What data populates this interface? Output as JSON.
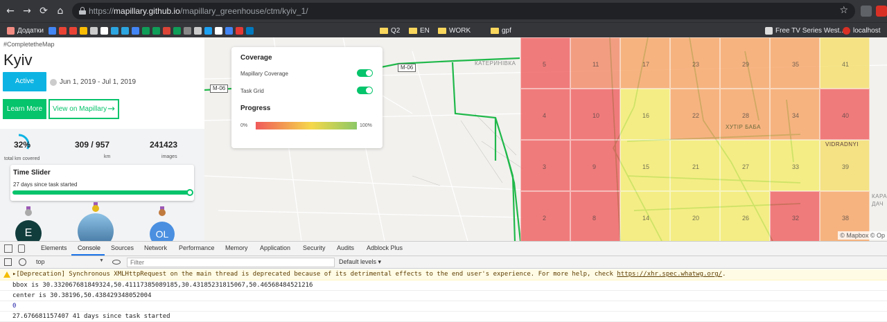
{
  "browser": {
    "url_host": "mapillary.github.io",
    "url_path": "/mapillary_greenhouse/ctm/kyiv_1/",
    "url_scheme": "https://",
    "bookmarks": [
      "Додатки",
      "Q2",
      "EN",
      "WORK",
      "gpf",
      "Free TV Series West...",
      "localhost"
    ]
  },
  "sidebar": {
    "hashtag": "#CompletetheMap",
    "city": "Kyiv",
    "active_label": "Active",
    "dates": "Jun 1, 2019 - Jul 1, 2019",
    "learn_more": "Learn More",
    "view_on": "View on Mapillary",
    "percent": "32%",
    "percent_value": 0.32,
    "percent_caption": "total km covered",
    "km": "309 / 957",
    "km_caption": "km",
    "images": "241423",
    "images_caption": "images",
    "slider_title": "Time Slider",
    "slider_sub": "27 days since task started",
    "slider_value": 1.0,
    "avatars": [
      "E",
      "",
      "OL"
    ]
  },
  "overlay": {
    "coverage_title": "Coverage",
    "mapillary_coverage": "Mapillary Coverage",
    "task_grid": "Task Grid",
    "progress_title": "Progress",
    "pct_min": "0%",
    "pct_max": "100%"
  },
  "map": {
    "grid": [
      [
        "5",
        "11",
        "17",
        "23",
        "29",
        "35",
        "41"
      ],
      [
        "4",
        "10",
        "16",
        "22",
        "28",
        "34",
        "40"
      ],
      [
        "3",
        "9",
        "15",
        "21",
        "27",
        "33",
        "39"
      ],
      [
        "2",
        "8",
        "14",
        "20",
        "26",
        "32",
        "38"
      ]
    ],
    "colors": [
      [
        "#f06262",
        "#f38b6a",
        "#f7a668",
        "#f7a668",
        "#f7a668",
        "#f7a668",
        "#f5df6e"
      ],
      [
        "#f06262",
        "#f06262",
        "#f5ed6e",
        "#f7a668",
        "#f7a668",
        "#f7a668",
        "#f06262"
      ],
      [
        "#f06262",
        "#f06262",
        "#f5ed6e",
        "#f5ed6e",
        "#f5ed6e",
        "#f5ed6e",
        "#f5df6e"
      ],
      [
        "#f06262",
        "#f06262",
        "#f5ed6e",
        "#f5ed6e",
        "#f5ed6e",
        "#f06262",
        "#f7a668"
      ]
    ],
    "places": [
      "КАТЕРИНІВКА",
      "ХУТІР БАБА",
      "VIDRADNYI",
      "КАРАВ ДАЧ"
    ],
    "road_signs": [
      "M-06",
      "M-06"
    ],
    "attribution": "© Mapbox © Op"
  },
  "devtools": {
    "tabs": [
      "Elements",
      "Console",
      "Sources",
      "Network",
      "Performance",
      "Memory",
      "Application",
      "Security",
      "Audits",
      "Adblock Plus"
    ],
    "context": "top",
    "filter_placeholder": "Filter",
    "levels": "Default levels",
    "warning": "[Deprecation] Synchronous XMLHttpRequest on the main thread is deprecated because of its detrimental effects to the end user's experience. For more help, check ",
    "warning_link": "https://xhr.spec.whatwg.org/",
    "warning_end": ".",
    "log1": "bbox is 30.332067681849324,50.41117385089185,30.43185231815067,50.46568484521216",
    "log2": "center is 30.38196,50.438429348052004",
    "log3": "0",
    "log4": "27.676681157407 41 days since task started"
  }
}
